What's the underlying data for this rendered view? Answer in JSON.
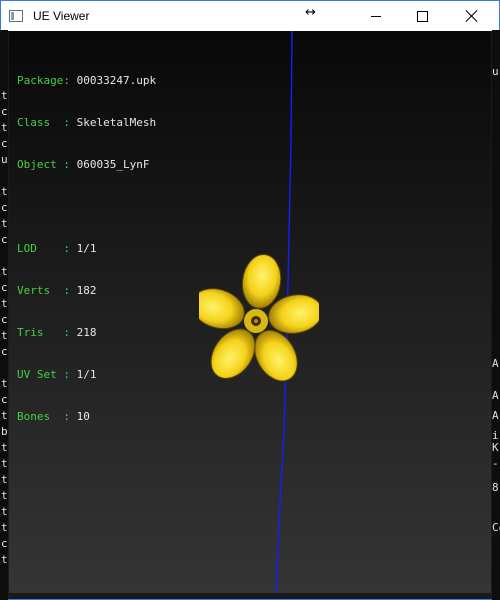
{
  "window": {
    "title": "UE Viewer",
    "resize_cursor": "↔"
  },
  "controls": {
    "minimize": "minimize-icon",
    "maximize": "maximize-icon",
    "close": "close-icon"
  },
  "info": {
    "mesh": [
      {
        "label": "Package: ",
        "value": "00033247.upk"
      },
      {
        "label": "Class  : ",
        "value": "SkeletalMesh"
      },
      {
        "label": "Object : ",
        "value": "060035_LynF"
      }
    ],
    "stats": [
      {
        "label": "LOD    : ",
        "value": "1/1"
      },
      {
        "label": "Verts  : ",
        "value": "182"
      },
      {
        "label": "Tris   : ",
        "value": "218"
      },
      {
        "label": "UV Set : ",
        "value": "1/1"
      },
      {
        "label": "Bones  : ",
        "value": "10"
      }
    ]
  },
  "background_console": {
    "left_column": [
      "t",
      "c",
      "t",
      "c",
      "u",
      "",
      "t",
      "c",
      "t",
      "c",
      "",
      "t",
      "c",
      "t",
      "c",
      "t",
      "c",
      "",
      "t",
      "c",
      "t",
      "b",
      "t",
      "t",
      "t",
      "t",
      "t",
      "t",
      "c",
      "t"
    ],
    "right_fragments": [
      "u",
      "A",
      "A",
      "A",
      "i",
      "K",
      "-",
      "8",
      "Co"
    ]
  },
  "colors": {
    "label": "#44d144",
    "value": "#e8e8e8",
    "axis": "#1a1aff",
    "flower": "#f5d21a"
  }
}
